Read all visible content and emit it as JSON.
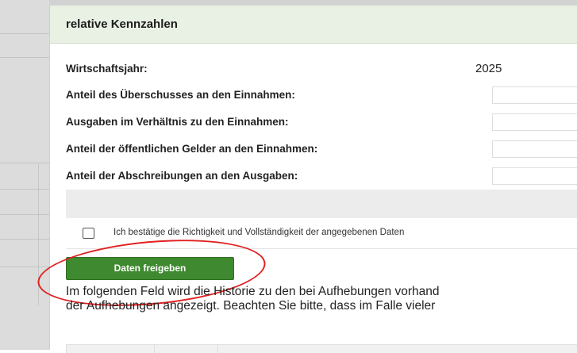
{
  "dialog": {
    "title": "relative Kennzahlen"
  },
  "fields": [
    {
      "label": "Wirtschaftsjahr:",
      "value": "2025"
    },
    {
      "label": "Anteil des Überschusses an den Einnahmen:",
      "value": ""
    },
    {
      "label": "Ausgaben im Verhältnis zu den Einnahmen:",
      "value": ""
    },
    {
      "label": "Anteil der öffentlichen Gelder an den Einnahmen:",
      "value": ""
    },
    {
      "label": "Anteil der Abschreibungen an den Ausgaben:",
      "value": ""
    }
  ],
  "confirm": {
    "label": "Ich bestätige die Richtigkeit und Vollständigkeit der angegebenen Daten",
    "checked": false
  },
  "release_button": {
    "label": "Daten freigeben"
  },
  "info": {
    "line1": "Im folgenden Feld wird die Historie zu den bei Aufhebungen vorhand",
    "line2": "der Aufhebungen angezeigt. Beachten Sie bitte, dass im Falle vieler"
  },
  "colors": {
    "header_bg": "#e8f1e3",
    "button_bg": "#3f8a30",
    "highlight": "#e02020"
  }
}
